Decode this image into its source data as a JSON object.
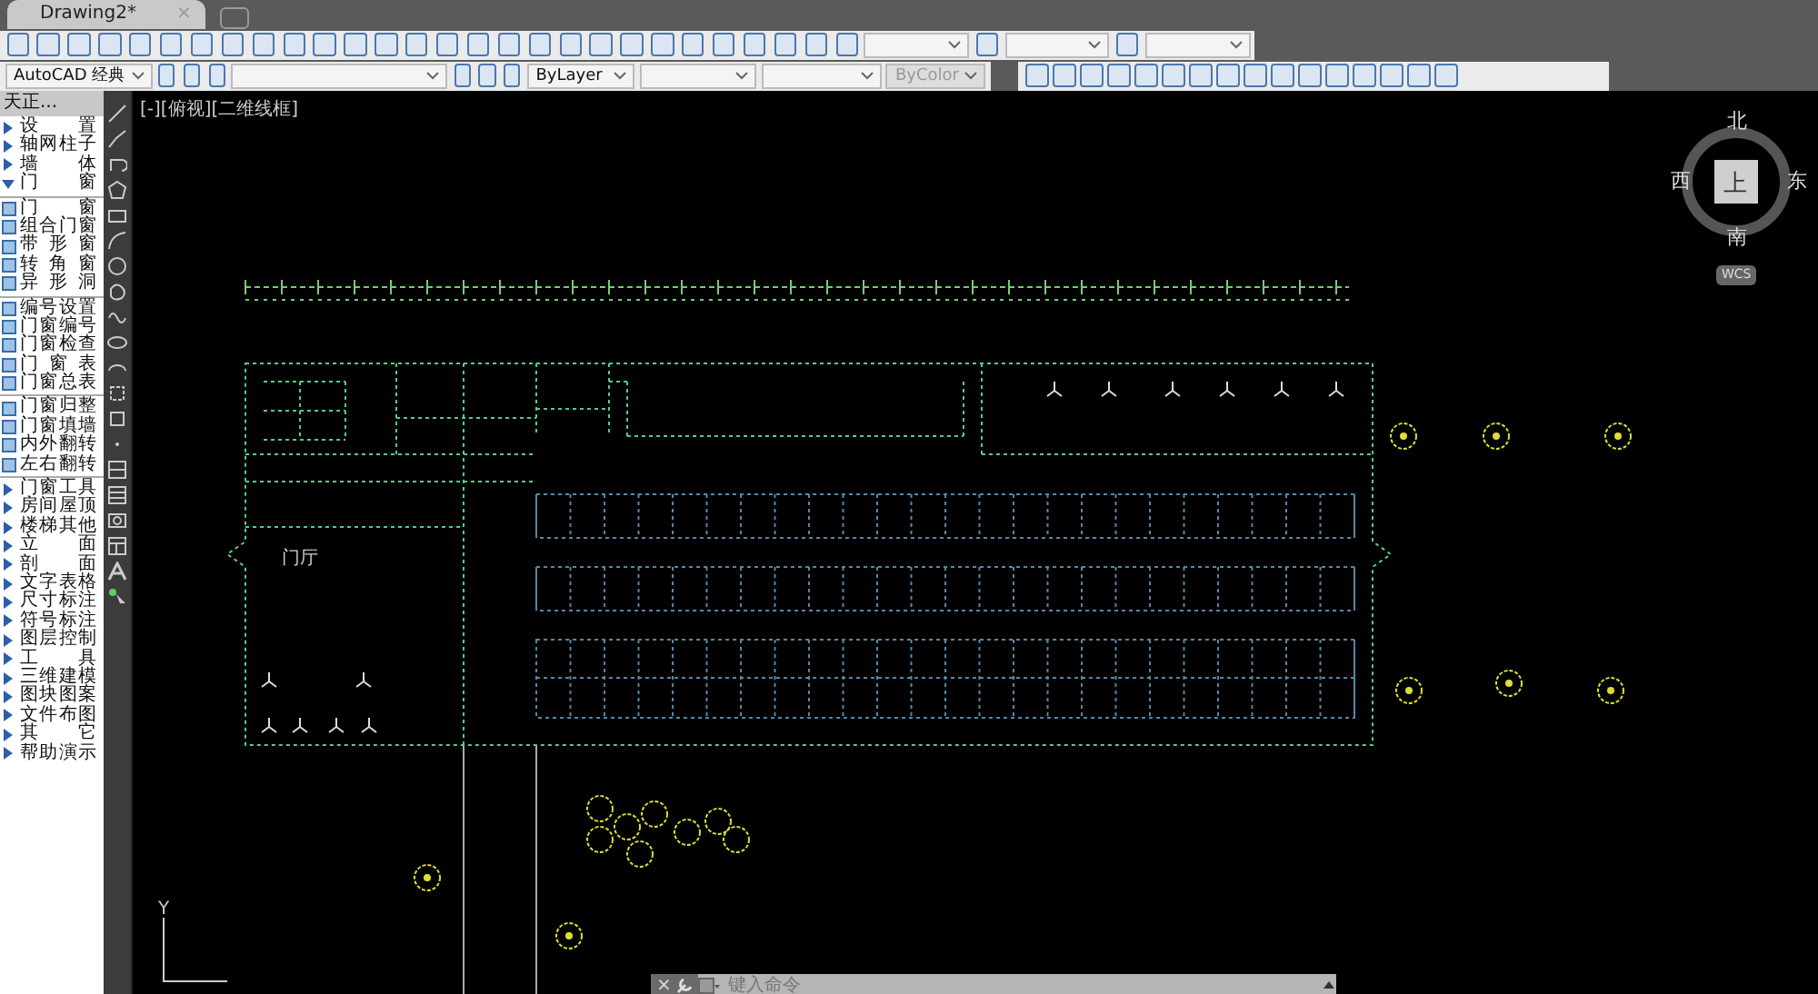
{
  "tabs": [
    {
      "label": "Drawing2*",
      "selected": true,
      "close": "×"
    }
  ],
  "toolbar": {
    "workspace": "AutoCAD 经典",
    "color_combo": "ByLayer",
    "plotstyle_combo": {
      "value": "ByColor",
      "disabled": true
    }
  },
  "sidebar": {
    "title": "天正...",
    "sections": [
      [
        {
          "kind": "group",
          "label": "设 置",
          "expanded": false
        },
        {
          "kind": "group",
          "label": "轴网柱子",
          "expanded": false
        },
        {
          "kind": "group",
          "label": "墙 体",
          "expanded": false
        },
        {
          "kind": "group",
          "label": "门 窗",
          "expanded": true
        }
      ],
      [
        {
          "kind": "tool",
          "label": "门 窗"
        },
        {
          "kind": "tool",
          "label": "组合门窗"
        },
        {
          "kind": "tool",
          "label": "带 形 窗"
        },
        {
          "kind": "tool",
          "label": "转 角 窗"
        },
        {
          "kind": "tool",
          "label": "异 形 洞"
        }
      ],
      [
        {
          "kind": "tool",
          "label": "编号设置"
        },
        {
          "kind": "tool",
          "label": "门窗编号"
        },
        {
          "kind": "tool",
          "label": "门窗检查"
        },
        {
          "kind": "tool",
          "label": "门 窗 表"
        },
        {
          "kind": "tool",
          "label": "门窗总表"
        }
      ],
      [
        {
          "kind": "tool",
          "label": "门窗归整"
        },
        {
          "kind": "tool",
          "label": "门窗填墙"
        },
        {
          "kind": "tool",
          "label": "内外翻转"
        },
        {
          "kind": "tool",
          "label": "左右翻转"
        }
      ],
      [
        {
          "kind": "group",
          "label": "门窗工具",
          "expanded": false
        },
        {
          "kind": "group",
          "label": "房间屋顶",
          "expanded": false
        },
        {
          "kind": "group",
          "label": "楼梯其他",
          "expanded": false
        },
        {
          "kind": "group",
          "label": "立 面",
          "expanded": false
        },
        {
          "kind": "group",
          "label": "剖 面",
          "expanded": false
        },
        {
          "kind": "group",
          "label": "文字表格",
          "expanded": false
        },
        {
          "kind": "group",
          "label": "尺寸标注",
          "expanded": false
        },
        {
          "kind": "group",
          "label": "符号标注",
          "expanded": false
        },
        {
          "kind": "group",
          "label": "图层控制",
          "expanded": false
        },
        {
          "kind": "group",
          "label": "工 具",
          "expanded": false
        },
        {
          "kind": "group",
          "label": "三维建模",
          "expanded": false
        },
        {
          "kind": "group",
          "label": "图块图案",
          "expanded": false
        },
        {
          "kind": "group",
          "label": "文件布图",
          "expanded": false
        },
        {
          "kind": "group",
          "label": "其 它",
          "expanded": false
        },
        {
          "kind": "group",
          "label": "帮助演示",
          "expanded": false
        }
      ]
    ]
  },
  "viewport": {
    "label": "[-][俯视][二维线框]",
    "compass": {
      "north": "北",
      "south": "南",
      "west": "西",
      "east": "东",
      "center": "上",
      "wcs": "WCS"
    },
    "room_label": "门厅",
    "ucs_y": "Y"
  },
  "command_line": {
    "close": "×",
    "placeholder": "键入命令"
  }
}
